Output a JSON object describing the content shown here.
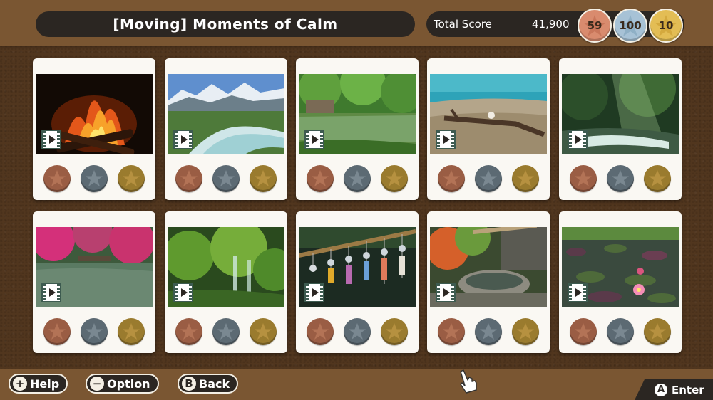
{
  "header": {
    "title": "[Moving] Moments of Calm",
    "score_label": "Total Score",
    "score_value": "41,900",
    "medals": {
      "bronze": "59",
      "silver": "100",
      "gold": "10"
    }
  },
  "colors": {
    "bronze": "#9a5d44",
    "silver": "#5c6a73",
    "gold": "#9a7b2e",
    "panel": "#2b2622"
  },
  "cards": [
    {
      "scene": "campfire",
      "icon": "film-play-icon"
    },
    {
      "scene": "mountain-river",
      "icon": "film-play-icon"
    },
    {
      "scene": "green-pond",
      "icon": "film-play-icon"
    },
    {
      "scene": "lake-shore-driftwood",
      "icon": "film-play-icon"
    },
    {
      "scene": "forest-stream-sunbeams",
      "icon": "film-play-icon"
    },
    {
      "scene": "autumn-pond",
      "icon": "film-play-icon"
    },
    {
      "scene": "mossy-waterfall",
      "icon": "film-play-icon"
    },
    {
      "scene": "wind-chimes",
      "icon": "film-play-icon"
    },
    {
      "scene": "garden-water-basin",
      "icon": "film-play-icon"
    },
    {
      "scene": "water-lilies",
      "icon": "film-play-icon"
    }
  ],
  "footer": {
    "help": {
      "glyph": "+",
      "label": "Help"
    },
    "option": {
      "glyph": "−",
      "label": "Option"
    },
    "back": {
      "glyph": "B",
      "label": "Back"
    },
    "enter": {
      "glyph": "A",
      "label": "Enter"
    }
  }
}
